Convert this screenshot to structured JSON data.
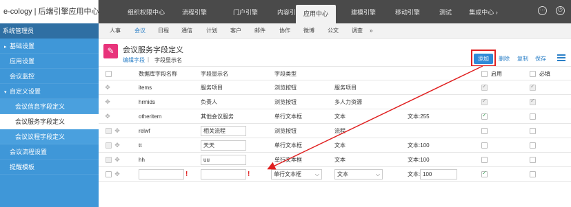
{
  "header": {
    "app_title": "e-cology | 后端引擎应用中心",
    "tabs": [
      "组织权限中心",
      "流程引擎",
      "门户引擎",
      "内容引擎",
      "应用中心",
      "建模引擎",
      "移动引擎",
      "测试",
      "集成中心 ›"
    ],
    "active_tab": "应用中心"
  },
  "sidebar": {
    "header": "系统管理员",
    "items": [
      {
        "label": "基础设置",
        "arrow": "▸"
      },
      {
        "label": "应用设置",
        "arrow": ""
      },
      {
        "label": "会议监控",
        "arrow": ""
      },
      {
        "label": "自定义设置",
        "arrow": "▾"
      },
      {
        "label": "会议信息字段定义",
        "arrow": ""
      },
      {
        "label": "会议服务字段定义",
        "arrow": ""
      },
      {
        "label": "会议议程字段定义",
        "arrow": ""
      },
      {
        "label": "会议流程设置",
        "arrow": ""
      },
      {
        "label": "提醒模板",
        "arrow": ""
      }
    ]
  },
  "subnav": {
    "tabs": [
      "人事",
      "会议",
      "日程",
      "通信",
      "计划",
      "客户",
      "邮件",
      "协作",
      "微博",
      "公文",
      "调查",
      "»"
    ],
    "active": "会议"
  },
  "page": {
    "title": "会议服务字段定义",
    "tab_edit": "编辑字段",
    "separator": "|",
    "tab_display": "字段显示名"
  },
  "toolbar": {
    "add": "添加",
    "delete": "删除",
    "copy": "复制",
    "save": "保存"
  },
  "table": {
    "headers": {
      "db_field": "数据库字段名称",
      "display": "字段显示名",
      "type": "字段类型",
      "enable": "启用",
      "required": "必填"
    },
    "rows": [
      {
        "db": "items",
        "display": "服务项目",
        "type": "浏览按钮",
        "sub": "服务项目",
        "extra": "",
        "enabled": true,
        "required": true,
        "locked": true,
        "editable": false
      },
      {
        "db": "hrmids",
        "display": "负责人",
        "type": "浏览按钮",
        "sub": "多人力资源",
        "extra": "",
        "enabled": true,
        "required": true,
        "locked": true,
        "editable": false
      },
      {
        "db": "otheritem",
        "display": "其他会议服务",
        "type": "单行文本框",
        "sub": "文本",
        "extra": "文本:255",
        "enabled": true,
        "required": false,
        "locked": false,
        "editable": false
      },
      {
        "db": "relwf",
        "display": "相关流程",
        "type": "浏览按钮",
        "sub": "流程",
        "extra": "",
        "enabled": false,
        "required": false,
        "locked": false,
        "editable": true
      },
      {
        "db": "tt",
        "display": "天天",
        "type": "单行文本框",
        "sub": "文本",
        "extra": "文本:100",
        "enabled": false,
        "required": false,
        "locked": false,
        "editable": true
      },
      {
        "db": "hh",
        "display": "uu",
        "type": "单行文本框",
        "sub": "文本",
        "extra": "文本:100",
        "enabled": false,
        "required": false,
        "locked": false,
        "editable": true
      }
    ],
    "new_row": {
      "db": "",
      "display": "",
      "type": "单行文本框",
      "sub": "文本",
      "extra_label": "文本:",
      "extra_value": "100",
      "enabled": true,
      "required": false,
      "required_mark": "!"
    }
  },
  "colors": {
    "sidebar": "#3f97d8",
    "accent": "#2e8ad8",
    "highlight": "#e02020",
    "page_icon": "#e8337b"
  }
}
